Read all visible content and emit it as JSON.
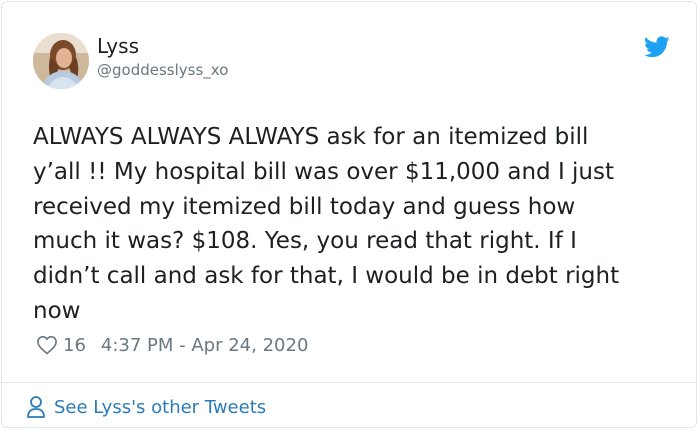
{
  "author": {
    "name": "Lyss",
    "handle": "@goddesslyss_xo",
    "avatar_icon": "avatar"
  },
  "tweet": {
    "text": "ALWAYS ALWAYS ALWAYS ask for an itemized bill\ny’all !! My hospital bill was over $11,000 and I just\nreceived my itemized bill today and guess how\nmuch it was? $108. Yes, you read that right. If I\ndidn’t call and ask for that, I would be in debt right\nnow",
    "likes": "16",
    "timestamp": "4:37 PM - Apr 24, 2020"
  },
  "footer": {
    "link_label": "See Lyss's other Tweets"
  },
  "colors": {
    "text": "#1c2022",
    "muted": "#697882",
    "link": "#2b7bb9",
    "twitter_blue": "#1da1f2",
    "border": "#e1e8ed"
  }
}
